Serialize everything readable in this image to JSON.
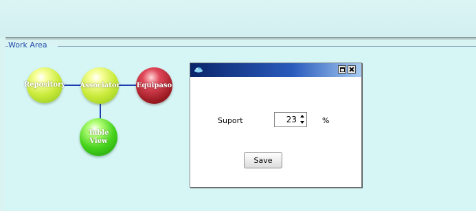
{
  "work_area": {
    "label": "Work Area"
  },
  "nodes": {
    "repository": {
      "line1": "Repository",
      "line2": ""
    },
    "associator": {
      "line1": "Associator",
      "line2": ""
    },
    "equipaso": {
      "line1": "Equipaso",
      "line2": ""
    },
    "table_view": {
      "line1": "Table",
      "line2": "View"
    }
  },
  "dialog": {
    "support_label": "Suport",
    "support_value": "23",
    "percent_sign": "%",
    "save_label": "Save"
  },
  "colors": {
    "background": "#d9f3f3",
    "connector": "#1e3fb2",
    "titlebar": "#0a246a"
  }
}
